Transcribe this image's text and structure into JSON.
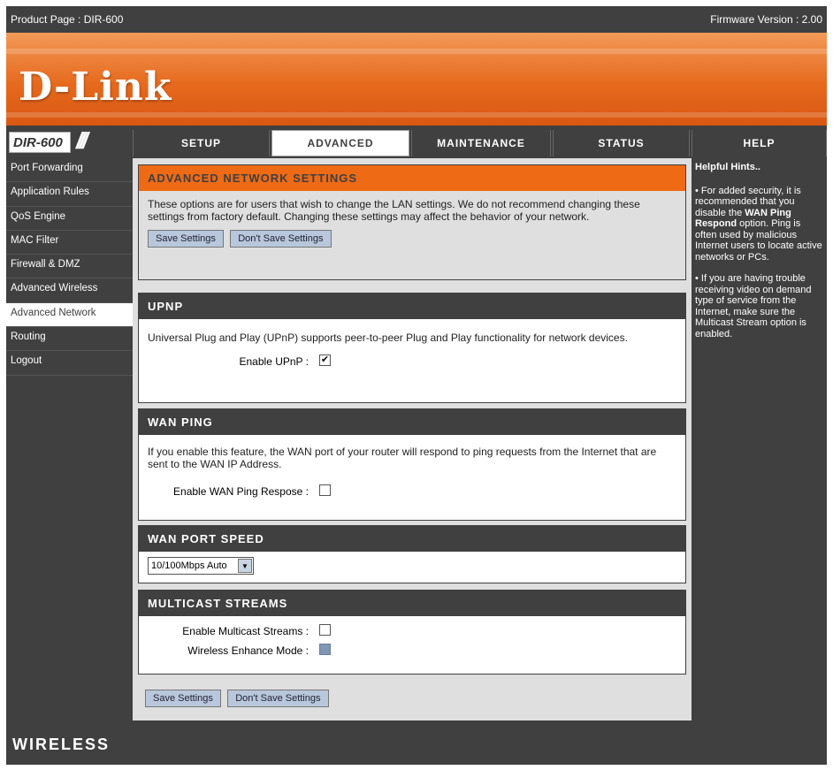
{
  "topbar": {
    "product_page": "Product Page : DIR-600",
    "firmware": "Firmware Version : 2.00"
  },
  "brand": {
    "logo": "D-Link",
    "model": "DIR-600",
    "footer": "WIRELESS"
  },
  "tabs": [
    {
      "label": "SETUP"
    },
    {
      "label": "ADVANCED",
      "active": true
    },
    {
      "label": "MAINTENANCE"
    },
    {
      "label": "STATUS"
    },
    {
      "label": "HELP"
    }
  ],
  "sidebar": {
    "items": [
      {
        "label": "Port Forwarding"
      },
      {
        "label": "Application Rules"
      },
      {
        "label": "QoS Engine"
      },
      {
        "label": "MAC Filter"
      },
      {
        "label": "Firewall & DMZ"
      },
      {
        "label": "Advanced Wireless"
      },
      {
        "label": "Advanced Network",
        "active": true
      },
      {
        "label": "Routing"
      },
      {
        "label": "Logout"
      }
    ]
  },
  "intro": {
    "title": "ADVANCED NETWORK SETTINGS",
    "text": "These options are for users that wish to change the LAN settings. We do not recommend changing these settings from factory default. Changing these settings may affect the behavior of your network.",
    "save_label": "Save Settings",
    "dont_save_label": "Don't Save Settings"
  },
  "upnp": {
    "title": "UPNP",
    "text": "Universal Plug and Play (UPnP) supports peer-to-peer Plug and Play functionality for network devices.",
    "enable_label": "Enable UPnP :",
    "enable_checked": true
  },
  "wan_ping": {
    "title": "WAN PING",
    "text": "If you enable this feature, the WAN port of your router will respond to ping requests from the Internet that are sent to the WAN IP Address.",
    "enable_label": "Enable WAN Ping Respose :",
    "enable_checked": false
  },
  "wan_port_speed": {
    "title": "WAN PORT SPEED",
    "selected": "10/100Mbps Auto"
  },
  "multicast": {
    "title": "MULTICAST STREAMS",
    "enable_label": "Enable Multicast Streams :",
    "enable_checked": false,
    "wireless_label": "Wireless Enhance Mode :",
    "wireless_disabled": true
  },
  "bottom": {
    "save_label": "Save Settings",
    "dont_save_label": "Don't Save Settings"
  },
  "help": {
    "title": "Helpful Hints..",
    "hint1_prefix": "• For added security, it is recommended that you disable the ",
    "hint1_bold1": "WAN Ping Respond",
    "hint1_suffix": " option. Ping is often used by malicious Internet users to locate active networks or PCs.",
    "hint2": "• If you are having trouble receiving video on demand type of service from the Internet, make sure the Multicast Stream option is enabled."
  },
  "colors": {
    "banner_orange": "#e66a1e",
    "nav_dark": "#404040",
    "section_header_orange": "#ef6a15",
    "button_blue": "#b8c7dc"
  }
}
